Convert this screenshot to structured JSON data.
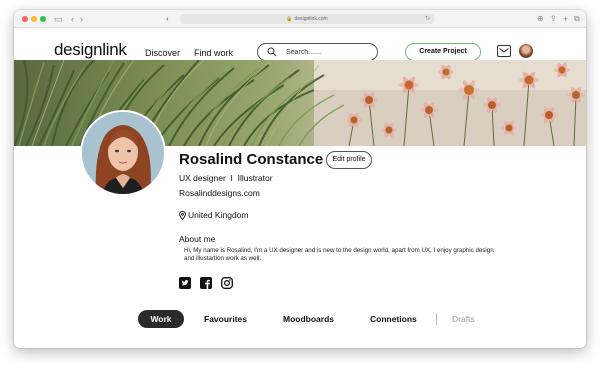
{
  "browser": {
    "url": "designlink.com"
  },
  "site": {
    "logo": "designlink",
    "nav_links": [
      "Discover",
      "Find work"
    ],
    "search_placeholder": "Search.......",
    "create_button": "Create Project"
  },
  "profile": {
    "name": "Rosalind Constance",
    "edit_button": "Edit profile",
    "role": "UX designer  I  Illustrator",
    "website": "Rosalinddesigns.com",
    "location": "United Kingdom",
    "about_title": "About me",
    "about_text": "Hi, My name is Rosalind, I'm a UX designer and is new to the design world, apart from UX, I enjoy graphic design and illustartion work as well."
  },
  "tabs": {
    "items": [
      "Work",
      "Favourites",
      "Moodboards",
      "Connetions",
      "Drafts"
    ],
    "active": "Work"
  },
  "colors": {
    "accent_green": "#6cbf6a",
    "active_tab": "#2b2b2b"
  }
}
